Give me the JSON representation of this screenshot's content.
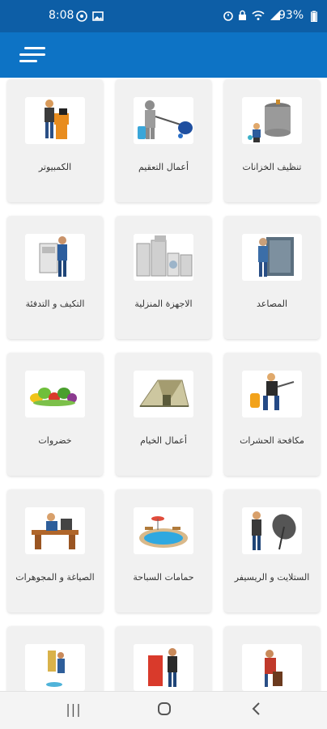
{
  "status": {
    "time": "8:08",
    "battery": "93%",
    "left_icons": [
      "whatsapp-icon",
      "image-icon"
    ],
    "right_icons": [
      "alarm-icon",
      "lock-icon",
      "wifi-icon",
      "signal-icon"
    ]
  },
  "appbar": {
    "menu_icon": "menu-icon",
    "color": "#0d73c5"
  },
  "services": [
    {
      "label": "تنظيف الخزانات"
    },
    {
      "label": "أعمال التعقيم"
    },
    {
      "label": "الكمبيوتر"
    },
    {
      "label": "المصاعد"
    },
    {
      "label": "الاجهزة المنزلية"
    },
    {
      "label": "التكيف و التدفئة"
    },
    {
      "label": "مكافحة الحشرات"
    },
    {
      "label": "أعمال الخيام"
    },
    {
      "label": "خضروات"
    },
    {
      "label": "الستلايت و الريسيفر"
    },
    {
      "label": "حمامات السباحة"
    },
    {
      "label": "الصياغة و المجوهرات"
    },
    {
      "label": ""
    },
    {
      "label": ""
    },
    {
      "label": ""
    }
  ],
  "navbar": {
    "recents": "|||",
    "home": "○",
    "back": "‹"
  }
}
